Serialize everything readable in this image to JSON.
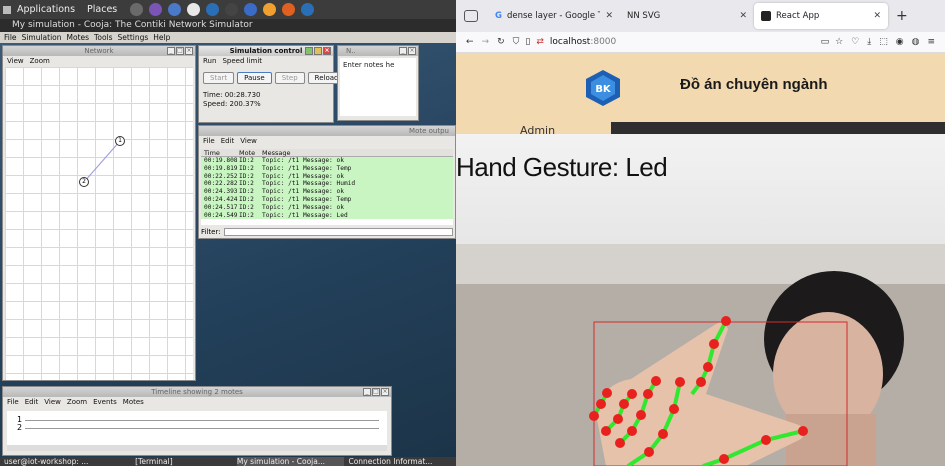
{
  "desktop": {
    "menu": {
      "applications": "Applications",
      "places": "Places"
    },
    "taskbar_icon_colors": [
      "#6a6a6a",
      "#7b55b5",
      "#4a79c9",
      "#e8e8e8",
      "#2a6fb5",
      "#444444",
      "#3a6bc7",
      "#f0a030",
      "#e06020",
      "#2a6fb5"
    ]
  },
  "cooja": {
    "window_title": "My simulation - Cooja: The Contiki Network Simulator",
    "menu": [
      "File",
      "Simulation",
      "Motes",
      "Tools",
      "Settings",
      "Help"
    ],
    "network": {
      "title": "Network",
      "menu": [
        "View",
        "Zoom"
      ],
      "motes": [
        {
          "id": "1"
        },
        {
          "id": "2"
        }
      ]
    },
    "sim_control": {
      "title": "Simulation control",
      "menu": [
        "Run",
        "Speed limit"
      ],
      "buttons": {
        "start": "Start",
        "pause": "Pause",
        "step": "Step",
        "reload": "Reload"
      },
      "time": "Time: 00:28.730",
      "speed": "Speed: 200.37%"
    },
    "notes": {
      "title": "N..",
      "placeholder": "Enter notes he"
    },
    "mote_output": {
      "title": "Mote outpu",
      "menu": [
        "File",
        "Edit",
        "View"
      ],
      "columns": [
        "Time",
        "Mote",
        "Message"
      ],
      "rows": [
        [
          "00:19.808",
          "ID:2",
          "Topic: /t1 Message: ok"
        ],
        [
          "00:19.819",
          "ID:2",
          "Topic: /t1 Message: Temp"
        ],
        [
          "00:22.252",
          "ID:2",
          "Topic: /t1 Message: ok"
        ],
        [
          "00:22.282",
          "ID:2",
          "Topic: /t1 Message: Humid"
        ],
        [
          "00:24.393",
          "ID:2",
          "Topic: /t1 Message: ok"
        ],
        [
          "00:24.424",
          "ID:2",
          "Topic: /t1 Message: Temp"
        ],
        [
          "00:24.517",
          "ID:2",
          "Topic: /t1 Message: ok"
        ],
        [
          "00:24.549",
          "ID:2",
          "Topic: /t1 Message: Led"
        ]
      ],
      "filter_label": "Filter:"
    },
    "timeline": {
      "title": "Timeline showing 2 motes",
      "menu": [
        "File",
        "Edit",
        "View",
        "Zoom",
        "Events",
        "Motes"
      ],
      "motes": [
        "1",
        "2"
      ]
    }
  },
  "taskbar": [
    {
      "label": "user@iot-workshop: ..."
    },
    {
      "label": "[Terminal]"
    },
    {
      "label": "My simulation - Cooja..."
    },
    {
      "label": "Connection Informat..."
    }
  ],
  "browser": {
    "tabs": [
      {
        "title": "dense layer - Google Tìm kiếm",
        "active": false
      },
      {
        "title": "NN SVG",
        "active": false
      },
      {
        "title": "React App",
        "active": true
      }
    ],
    "new_tab": "+",
    "url_host": "localhost",
    "url_port": ":8000"
  },
  "app": {
    "logo_text": "BK",
    "title": "Đồ án chuyên ngành",
    "sidebar_label": "Admin",
    "gesture_text": "Hand Gesture: Led",
    "accent": "#f3d9b0"
  }
}
